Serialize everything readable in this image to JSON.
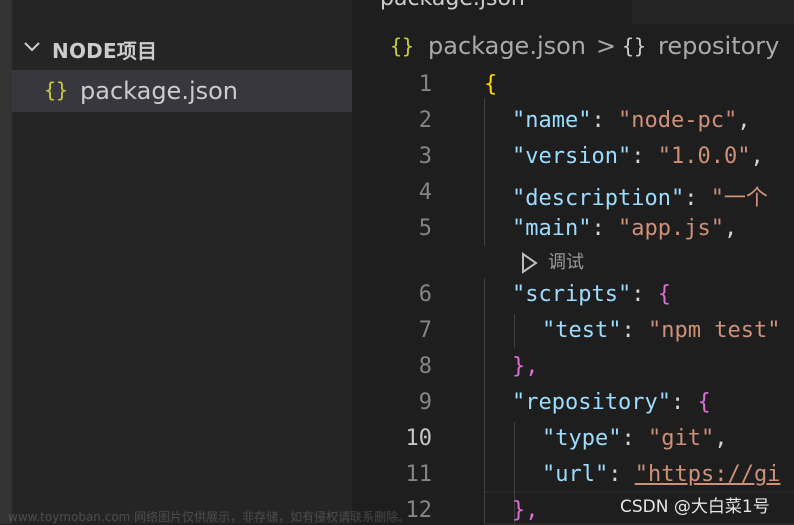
{
  "sidebar": {
    "section_title": "NODE项目",
    "file_icon": "{}",
    "file_name": "package.json"
  },
  "tab": {
    "label": "package.json"
  },
  "breadcrumb": {
    "file_icon": "{}",
    "file": "package.json",
    "separator": ">",
    "symbol_icon": "{}",
    "symbol": "repository"
  },
  "code": {
    "current_line": 10,
    "lines": [
      {
        "n": "1",
        "text": "{"
      },
      {
        "n": "2",
        "key": "\"name\"",
        "value": "\"node-pc\""
      },
      {
        "n": "3",
        "key": "\"version\"",
        "value": "\"1.0.0\""
      },
      {
        "n": "4",
        "key": "\"description\"",
        "value": "\"一个"
      },
      {
        "n": "5",
        "key": "\"main\"",
        "value": "\"app.js\""
      },
      {
        "n": "6",
        "key": "\"scripts\"",
        "text": "{"
      },
      {
        "n": "7",
        "key": "\"test\"",
        "value": "\"npm test\""
      },
      {
        "n": "8",
        "text": "},"
      },
      {
        "n": "9",
        "key": "\"repository\"",
        "text": "{"
      },
      {
        "n": "10",
        "key": "\"type\"",
        "value": "\"git\""
      },
      {
        "n": "11",
        "key": "\"url\"",
        "value": "\"https://gi"
      },
      {
        "n": "12",
        "text": "},"
      }
    ],
    "codelens_label": "调试"
  },
  "watermark": {
    "csdn": "CSDN @大白菜1号",
    "site": "www.toymoban.com 网络图片仅供展示，非存储，如有侵权请联系删除。"
  },
  "colors": {
    "key": "#9cdcfe",
    "string": "#ce9178",
    "bracket_level1": "#ffd700",
    "bracket_level2": "#da70d6",
    "json_icon": "#cbcb41"
  }
}
